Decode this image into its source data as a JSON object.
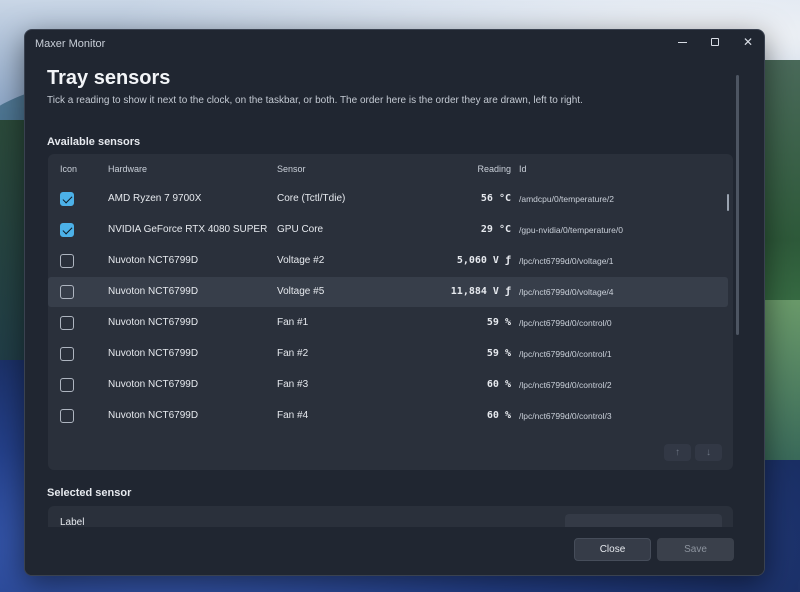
{
  "window": {
    "title": "Maxer Monitor"
  },
  "page": {
    "title": "Tray sensors",
    "description": "Tick a reading to show it next to the clock, on the taskbar, or both. The order here is the order they are drawn, left to right."
  },
  "sections": {
    "available": "Available sensors",
    "selected": "Selected sensor"
  },
  "table": {
    "columns": {
      "icon": "Icon",
      "hardware": "Hardware",
      "sensor": "Sensor",
      "reading": "Reading",
      "id": "Id"
    },
    "rows": [
      {
        "checked": true,
        "hardware": "AMD Ryzen 7 9700X",
        "sensor": "Core (Tctl/Tdie)",
        "reading": "56 °C",
        "id": "/amdcpu/0/temperature/2"
      },
      {
        "checked": true,
        "hardware": "NVIDIA GeForce RTX 4080 SUPER",
        "sensor": "GPU Core",
        "reading": "29 °C",
        "id": "/gpu-nvidia/0/temperature/0"
      },
      {
        "checked": false,
        "hardware": "Nuvoton NCT6799D",
        "sensor": "Voltage #2",
        "reading": "5,060 V ƒ",
        "id": "/lpc/nct6799d/0/voltage/1"
      },
      {
        "checked": false,
        "hardware": "Nuvoton NCT6799D",
        "sensor": "Voltage #5",
        "reading": "11,884 V ƒ",
        "id": "/lpc/nct6799d/0/voltage/4",
        "selected": true
      },
      {
        "checked": false,
        "hardware": "Nuvoton NCT6799D",
        "sensor": "Fan #1",
        "reading": "59 %",
        "id": "/lpc/nct6799d/0/control/0"
      },
      {
        "checked": false,
        "hardware": "Nuvoton NCT6799D",
        "sensor": "Fan #2",
        "reading": "59 %",
        "id": "/lpc/nct6799d/0/control/1"
      },
      {
        "checked": false,
        "hardware": "Nuvoton NCT6799D",
        "sensor": "Fan #3",
        "reading": "60 %",
        "id": "/lpc/nct6799d/0/control/2"
      },
      {
        "checked": false,
        "hardware": "Nuvoton NCT6799D",
        "sensor": "Fan #4",
        "reading": "60 %",
        "id": "/lpc/nct6799d/0/control/3"
      }
    ],
    "move_up_icon": "arrow-up-icon",
    "move_down_icon": "arrow-down-icon"
  },
  "selected_sensor": {
    "label_caption": "Label",
    "label_value": ""
  },
  "footer": {
    "close_label": "Close",
    "save_label": "Save"
  },
  "colors": {
    "accent": "#4cb1e8",
    "window_bg": "#202631",
    "card_bg": "#2a303b"
  }
}
